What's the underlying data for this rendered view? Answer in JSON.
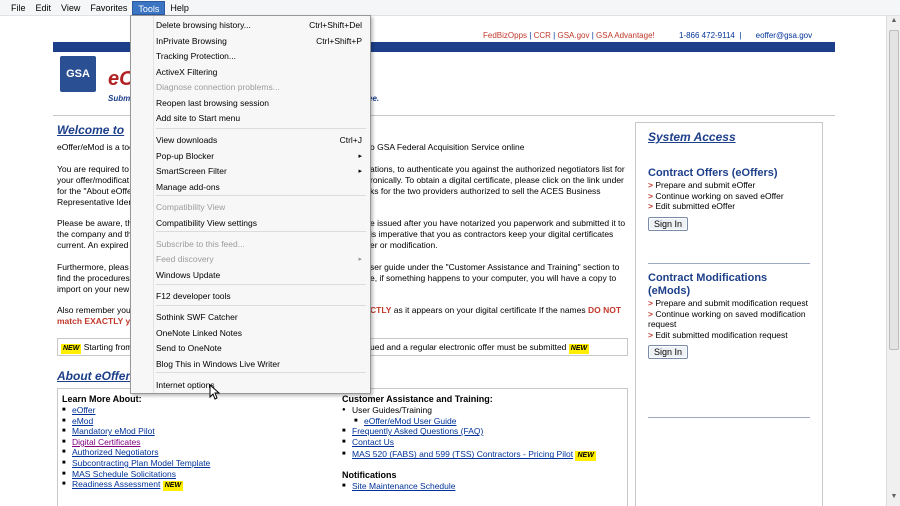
{
  "menubar": [
    "File",
    "Edit",
    "View",
    "Favorites",
    "Tools",
    "Help"
  ],
  "toplinks": {
    "fedbizopps": "FedBizOpps",
    "ccr": "CCR",
    "gsagov": "GSA.gov",
    "advantage": "GSA Advantage!",
    "phone": "1-866 472-9114",
    "email": "eoffer@gsa.gov"
  },
  "logo": "GSA",
  "brand": "eO",
  "tagline": "Subm",
  "tagline_end": "ee.",
  "welcome": {
    "title": "Welcome to",
    "p1a": "eOffer/eMod is a too",
    "p1b": "o GSA Federal Acquisition Service online",
    "p2a": "You are required to",
    "p2b": "your offer/modificat",
    "p2c": "for the \"About eOffer\"",
    "p2d": "Representative Iden",
    "p2r1": "ations, to authenticate you against the authorized negotiators list for",
    "p2r2": "ronically. To obtain a digital certificate, please click on the link under",
    "p2r3": "ks for the two providers authorized to sell the ACES Business",
    "p3a": "Please be aware, th",
    "p3b": "the company and th",
    "p3c": "current. An expired c",
    "p3r1": "e issued after you have notarized you paperwork and submitted it to",
    "p3r2": "is imperative that you as contractors keep your digital certificates",
    "p3r3": "er or modification.",
    "p4a": "Furthermore, pleas",
    "p4b": "find the procedures",
    "p4c": "import on your new",
    "p4r1": "ser guide under the \"Customer Assistance and Training\" section to",
    "p4r2": "e, if something happens to your computer, you will have a copy to",
    "p5a": "Also remember you",
    "p5b": "match EXACTLY you",
    "p5r1": "CTLY",
    "p5r2": "as it appears on your digital certificate  If the names",
    "p5r3": "DO NOT"
  },
  "notice": {
    "new": "NEW",
    "left": "Starting from",
    "right": "ued and a regular electronic offer must be submitted"
  },
  "about": {
    "title": "About eOffer",
    "learn_title": "Learn More About:",
    "learn": [
      "eOffer",
      "eMod",
      "Mandatory eMod Pilot",
      "Digital Certificates",
      "Authorized Negotiators",
      "Subcontracting Plan Model Template",
      "MAS Schedule Solicitations",
      "Readiness Assessment"
    ],
    "cat_title": "Customer Assistance and Training:",
    "cat_guides": "User Guides/Training",
    "cat_items": [
      "eOffer/eMod User Guide",
      "Frequently Asked Questions (FAQ)",
      "Contact Us",
      "MAS 520 (FABS) and 599 (TSS) Contractors - Pricing Pilot"
    ],
    "notif_title": "Notifications",
    "notif_items": [
      "Site Maintenance Schedule"
    ]
  },
  "sidebar": {
    "title": "System Access",
    "offers_title": "Contract Offers (eOffers)",
    "offers_items": [
      "Prepare and submit eOffer",
      "Continue working on saved eOffer",
      "Edit submitted eOffer"
    ],
    "signin": "Sign In",
    "mods_title_1": "Contract Modifications",
    "mods_title_2": "(eMods)",
    "mods_items": [
      "Prepare and submit modification request",
      "Continue working on saved modification request",
      "Edit submitted modification request"
    ]
  },
  "tools_menu": [
    {
      "label": "Delete browsing history...",
      "shortcut": "Ctrl+Shift+Del",
      "disabled": false
    },
    {
      "label": "InPrivate Browsing",
      "shortcut": "Ctrl+Shift+P",
      "disabled": false
    },
    {
      "label": "Tracking Protection...",
      "shortcut": "",
      "disabled": false
    },
    {
      "label": "ActiveX Filtering",
      "shortcut": "",
      "disabled": false
    },
    {
      "label": "Diagnose connection problems...",
      "shortcut": "",
      "disabled": true
    },
    {
      "label": "Reopen last browsing session",
      "shortcut": "",
      "disabled": false
    },
    {
      "label": "Add site to Start menu",
      "shortcut": "",
      "disabled": false
    },
    {
      "label": "View downloads",
      "shortcut": "Ctrl+J",
      "disabled": false
    },
    {
      "label": "Pop-up Blocker",
      "shortcut": "",
      "disabled": false,
      "submenu": true
    },
    {
      "label": "SmartScreen Filter",
      "shortcut": "",
      "disabled": false,
      "submenu": true
    },
    {
      "label": "Manage add-ons",
      "shortcut": "",
      "disabled": false
    },
    {
      "label": "Compatibility View",
      "shortcut": "",
      "disabled": true
    },
    {
      "label": "Compatibility View settings",
      "shortcut": "",
      "disabled": false
    },
    {
      "label": "Subscribe to this feed...",
      "shortcut": "",
      "disabled": true
    },
    {
      "label": "Feed discovery",
      "shortcut": "",
      "disabled": true,
      "submenu": true
    },
    {
      "label": "Windows Update",
      "shortcut": "",
      "disabled": false
    },
    {
      "label": "F12 developer tools",
      "shortcut": "",
      "disabled": false
    },
    {
      "label": "Sothink SWF Catcher",
      "shortcut": "",
      "disabled": false
    },
    {
      "label": "OneNote Linked Notes",
      "shortcut": "",
      "disabled": false
    },
    {
      "label": "Send to OneNote",
      "shortcut": "",
      "disabled": false
    },
    {
      "label": "Blog This in Windows Live Writer",
      "shortcut": "",
      "disabled": false
    },
    {
      "label": "Internet options",
      "shortcut": "",
      "disabled": false
    }
  ]
}
